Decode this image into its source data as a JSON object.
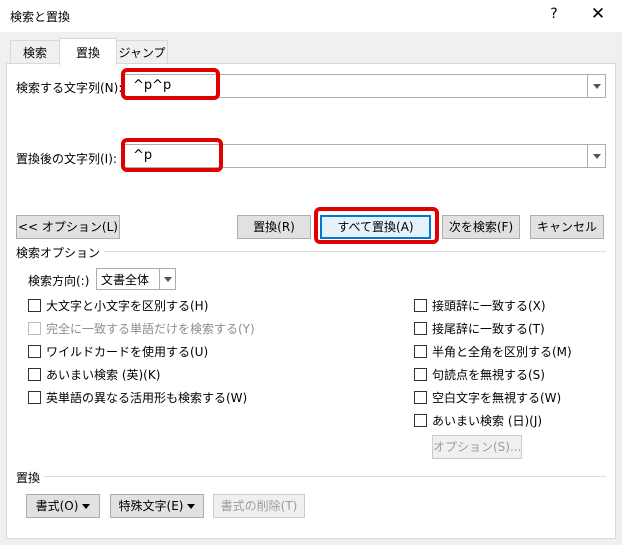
{
  "window": {
    "title": "検索と置換",
    "help_label": "?",
    "close_label": "✕"
  },
  "tabs": [
    {
      "label": "検索"
    },
    {
      "label": "置換"
    },
    {
      "label": "ジャンプ"
    }
  ],
  "find": {
    "label": "検索する文字列(N):",
    "value": "^p^p"
  },
  "replace": {
    "label": "置換後の文字列(I):",
    "value": "^p"
  },
  "buttons": {
    "options": "<< オプション(L)",
    "replace": "置換(R)",
    "replace_all": "すべて置換(A)",
    "find_next": "次を検索(F)",
    "cancel": "キャンセル"
  },
  "search_options": {
    "section_label": "検索オプション",
    "direction_label": "検索方向(:)",
    "direction_value": "文書全体",
    "left_checks": [
      {
        "label": "大文字と小文字を区別する(H)",
        "checked": false,
        "disabled": false
      },
      {
        "label": "完全に一致する単語だけを検索する(Y)",
        "checked": false,
        "disabled": true
      },
      {
        "label": "ワイルドカードを使用する(U)",
        "checked": false,
        "disabled": false
      },
      {
        "label": "あいまい検索 (英)(K)",
        "checked": false,
        "disabled": false
      },
      {
        "label": "英単語の異なる活用形も検索する(W)",
        "checked": false,
        "disabled": false
      }
    ],
    "right_checks": [
      {
        "label": "接頭辞に一致する(X)",
        "checked": false,
        "disabled": false
      },
      {
        "label": "接尾辞に一致する(T)",
        "checked": false,
        "disabled": false
      },
      {
        "label": "半角と全角を区別する(M)",
        "checked": false,
        "disabled": false
      },
      {
        "label": "句読点を無視する(S)",
        "checked": false,
        "disabled": false
      },
      {
        "label": "空白文字を無視する(W)",
        "checked": false,
        "disabled": false
      },
      {
        "label": "あいまい検索 (日)(J)",
        "checked": false,
        "disabled": false
      }
    ],
    "fuzzy_options_button": "オプション(S)..."
  },
  "replace_section": {
    "section_label": "置換",
    "format_button": "書式(O)",
    "special_button": "特殊文字(E)",
    "no_format_button": "書式の削除(T)"
  },
  "colors": {
    "highlight": "#e00000",
    "primary_border": "#0078d7"
  }
}
